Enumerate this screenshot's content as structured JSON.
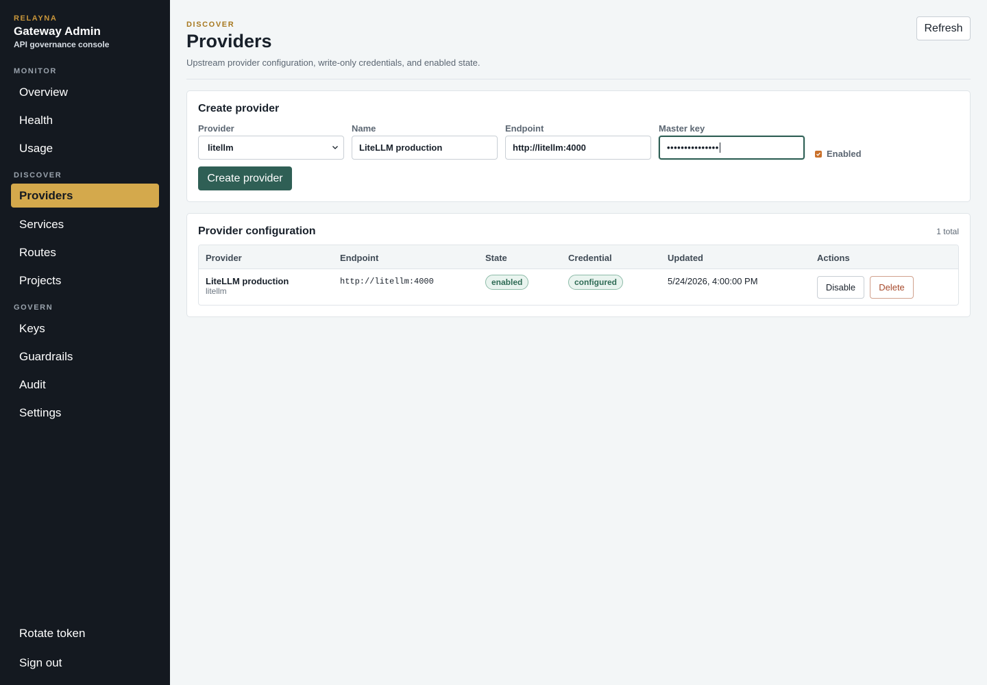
{
  "brand": {
    "eyebrow": "RELAYNA",
    "title": "Gateway Admin",
    "subtitle": "API governance console"
  },
  "sidebar": {
    "sections": [
      {
        "label": "MONITOR",
        "items": [
          "Overview",
          "Health",
          "Usage"
        ]
      },
      {
        "label": "DISCOVER",
        "items": [
          "Providers",
          "Services",
          "Routes",
          "Projects"
        ]
      },
      {
        "label": "GOVERN",
        "items": [
          "Keys",
          "Guardrails",
          "Audit",
          "Settings"
        ]
      }
    ],
    "active_item": "Providers",
    "footer": {
      "rotate_token": "Rotate token",
      "sign_out": "Sign out"
    }
  },
  "header": {
    "eyebrow": "DISCOVER",
    "title": "Providers",
    "description": "Upstream provider configuration, write-only credentials, and enabled state.",
    "refresh_label": "Refresh"
  },
  "create_form": {
    "title": "Create provider",
    "provider": {
      "label": "Provider",
      "value": "litellm"
    },
    "name": {
      "label": "Name",
      "value": "LiteLLM production"
    },
    "endpoint": {
      "label": "Endpoint",
      "value": "http://litellm:4000"
    },
    "master_key": {
      "label": "Master key",
      "masked_value": "•••••••••••••••"
    },
    "enabled": {
      "label": "Enabled",
      "checked": true
    },
    "submit_label": "Create provider"
  },
  "config": {
    "title": "Provider configuration",
    "total": "1 total",
    "columns": [
      "Provider",
      "Endpoint",
      "State",
      "Credential",
      "Updated",
      "Actions"
    ],
    "rows": [
      {
        "name": "LiteLLM production",
        "type": "litellm",
        "endpoint": "http://litellm:4000",
        "state": "enabled",
        "credential": "configured",
        "updated": "5/24/2026, 4:00:00 PM",
        "actions": {
          "disable": "Disable",
          "delete": "Delete"
        }
      }
    ]
  },
  "colors": {
    "sidebar_bg": "#141920",
    "accent_gold": "#d4a94c",
    "primary_green": "#2f5f55",
    "danger": "#a6482a"
  }
}
